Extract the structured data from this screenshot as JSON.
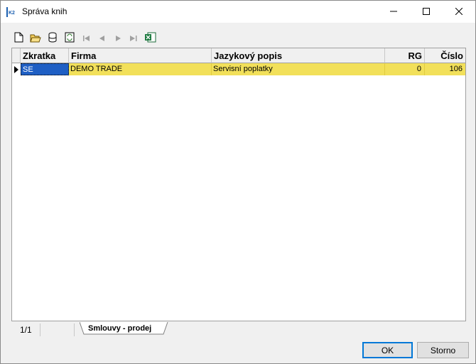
{
  "window": {
    "title": "Správa knih",
    "app_icon": "k2-app-icon"
  },
  "title_controls": [
    "minimize-icon",
    "maximize-icon",
    "close-icon"
  ],
  "toolbar": {
    "buttons": [
      "new-document-icon",
      "open-folder-icon",
      "database-icon",
      "refresh-icon",
      "first-record-icon",
      "previous-record-icon",
      "next-record-icon",
      "last-record-icon",
      "excel-export-icon"
    ]
  },
  "grid": {
    "columns": [
      "Zkratka",
      "Firma",
      "Jazykový popis",
      "RG",
      "Číslo"
    ],
    "rows": [
      {
        "zkratka": "SE",
        "firma": "DEMO TRADE",
        "popis": "Servisní poplatky",
        "rg": "0",
        "cislo": "106"
      }
    ]
  },
  "status": {
    "counter": "1/1",
    "tab": "Smlouvy - prodej"
  },
  "buttons": {
    "ok": "OK",
    "storno": "Storno"
  },
  "colors": {
    "row_highlight": "#f2e05a",
    "selection": "#1f5fc4",
    "ok_border": "#0078d7"
  }
}
